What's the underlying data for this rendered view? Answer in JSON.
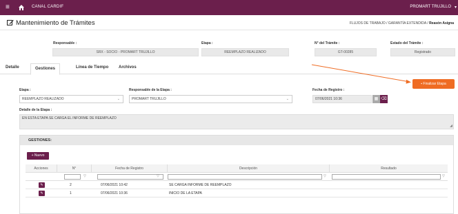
{
  "topbar": {
    "menu_icon": "hamburger-icon",
    "home_icon": "home-icon",
    "app_name": "CANAL CARDIF",
    "user": "PROMART TRUJILLO",
    "caret": "▾"
  },
  "header": {
    "title": "Mantenimiento de Trámites",
    "title_icon": "edit-icon",
    "breadcrumb_prefix": "FLUJOS DE TRABAJO / GARANTÍA EXTENDIDA / ",
    "breadcrumb_current": "Reasón Asigna"
  },
  "summary": {
    "responsable_label": "Responsable :",
    "responsable_value": "SRX - SOCIO - PROMART TRUJILLO",
    "etapa_label": "Etapa :",
    "etapa_value": "REEMPLAZO REALIZADO",
    "tramite_label": "N° del Trámite :",
    "tramite_value": "GT-00285",
    "estado_label": "Estado del Trámite :",
    "estado_value": "Registrado"
  },
  "tabs": [
    "Detalle",
    "Gestiones",
    "Línea de Tiempo",
    "Archivos"
  ],
  "active_tab": "Gestiones",
  "finalizar_button": "Finalizar Etapa",
  "form": {
    "etapa_label": "Etapa :",
    "etapa_value": "REEMPLAZO REALIZADO",
    "responsable_label": "Responsable de la Etapa :",
    "responsable_value": "PROMART TRUJILLO",
    "fecha_label": "Fecha de Registro :",
    "fecha_value": "07/06/2021 10:36",
    "detalle_label": "Detalle de la Etapa :",
    "detalle_value": "EN ESTA ETAPA SE CARGA EL INFORME DE REEMPLAZO"
  },
  "gestiones": {
    "panel_title": "GESTIONES:",
    "nuevo_button": "+ Nuevo",
    "columns": [
      "Acciones",
      "N°",
      "Fecha de Registro",
      "Descripción",
      "Resultado"
    ],
    "rows": [
      {
        "n": "2",
        "fecha": "07/06/2021 10:42",
        "descripcion": "SE CARGA INFORME DE REEMPLAZO",
        "resultado": ""
      },
      {
        "n": "1",
        "fecha": "07/06/2021 10:36",
        "descripcion": "INICIO DE LA ETAPA",
        "resultado": ""
      }
    ]
  },
  "colors": {
    "brand": "#6b1f4c",
    "accent": "#ef6c23"
  }
}
